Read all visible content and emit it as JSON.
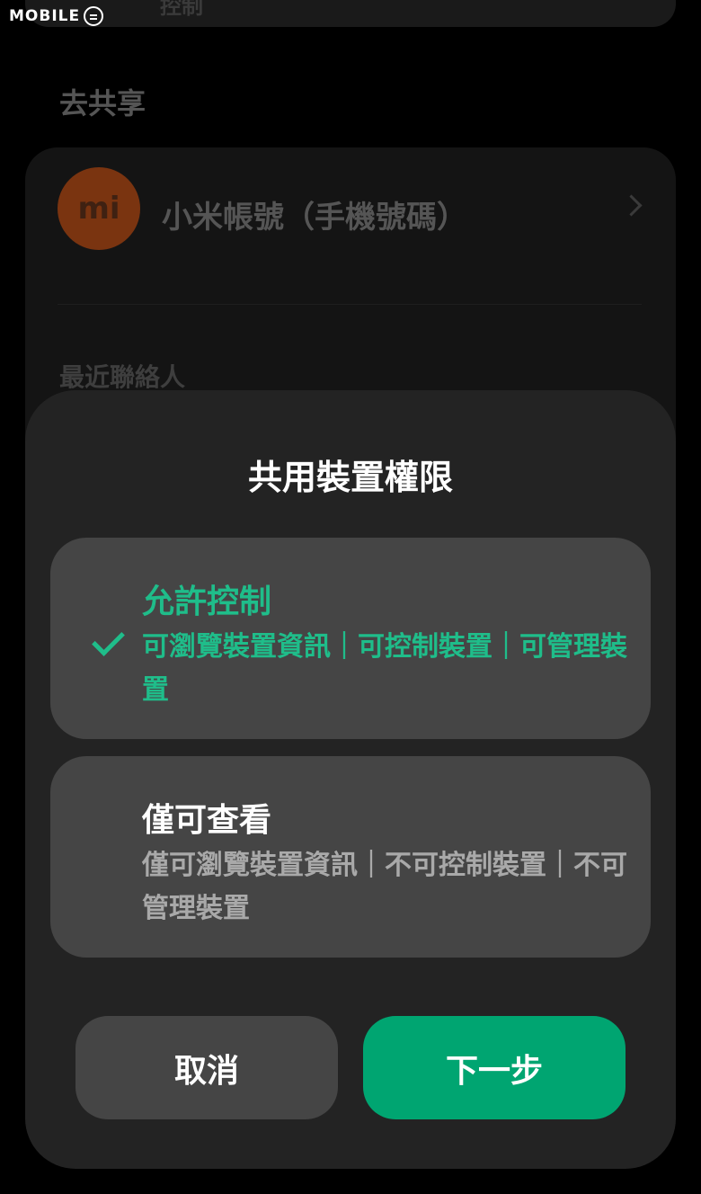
{
  "watermark": {
    "text": "MOBILE"
  },
  "background": {
    "top_card_text": "控制",
    "share_section_label": "去共享",
    "account": {
      "logo_text": "mi",
      "label": "小米帳號（手機號碼）"
    },
    "recent_contacts_label": "最近聯絡人"
  },
  "dialog": {
    "title": "共用裝置權限",
    "options": [
      {
        "title": "允許控制",
        "description": "可瀏覽裝置資訊｜可控制裝置｜可管理裝置",
        "selected": true
      },
      {
        "title": "僅可查看",
        "description": "僅可瀏覽裝置資訊｜不可控制裝置｜不可管理裝置",
        "selected": false
      }
    ],
    "cancel_label": "取消",
    "next_label": "下一步"
  },
  "colors": {
    "accent": "#1fbd8a",
    "primary_button": "#00a571",
    "sheet_bg": "#232323",
    "option_bg": "#454545"
  }
}
